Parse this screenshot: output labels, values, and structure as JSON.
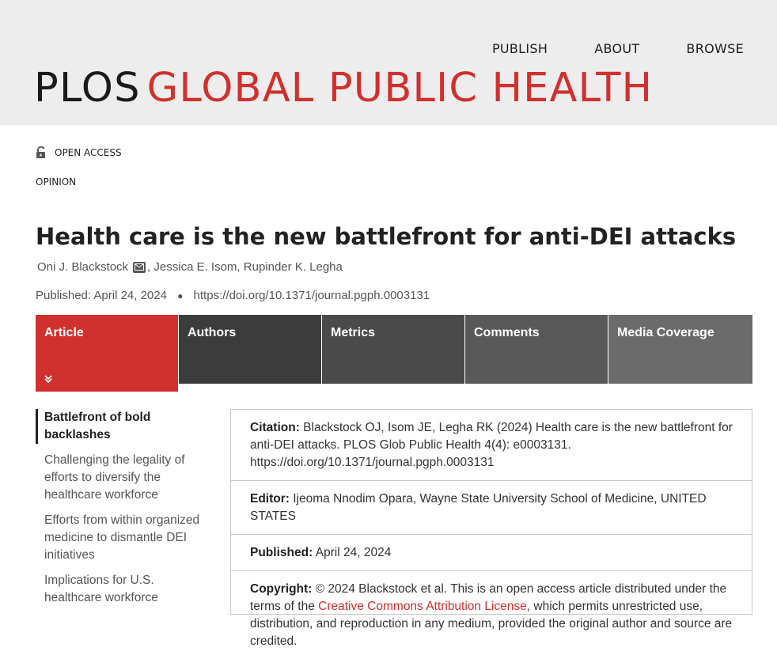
{
  "nav": {
    "publish": "PUBLISH",
    "about": "ABOUT",
    "browse": "BROWSE"
  },
  "logo": {
    "plos": "PLOS",
    "journal": "GLOBAL PUBLIC HEALTH"
  },
  "badge": {
    "open_access": "OPEN ACCESS",
    "article_type": "OPINION"
  },
  "article": {
    "title": "Health care is the new battlefront for anti-DEI attacks",
    "authors": [
      "Oni J. Blackstock",
      "Jessica E. Isom",
      "Rupinder K. Legha"
    ],
    "published_label": "Published: April 24, 2024",
    "doi": "https://doi.org/10.1371/journal.pgph.0003131"
  },
  "tabs": [
    "Article",
    "Authors",
    "Metrics",
    "Comments",
    "Media Coverage"
  ],
  "toc": [
    "Battlefront of bold backlashes",
    "Challenging the legality of efforts to diversify the healthcare workforce",
    "Efforts from within organized medicine to dismantle DEI initiatives",
    "Implications for U.S. healthcare workforce"
  ],
  "info": {
    "citation_label": "Citation:",
    "citation_text": "Blackstock OJ, Isom JE, Legha RK (2024) Health care is the new battlefront for anti-DEI attacks. PLOS Glob Public Health 4(4): e0003131. https://doi.org/10.1371/journal.pgph.0003131",
    "editor_label": "Editor:",
    "editor_text": "Ijeoma Nnodim Opara, Wayne State University School of Medicine, UNITED STATES",
    "published_label": "Published:",
    "published_text": "April 24, 2024",
    "copyright_label": "Copyright:",
    "copyright_text": "© 2024 Blackstock et al. This is an open access article distributed under the terms of the",
    "license_link": "Creative Commons Attribution License",
    "copyright_rest": ", which permits unrestricted use, distribution, and reproduction in any medium, provided the original author and source are credited."
  },
  "colors": {
    "accent": "#d0302e",
    "header_bg": "#ededed"
  }
}
